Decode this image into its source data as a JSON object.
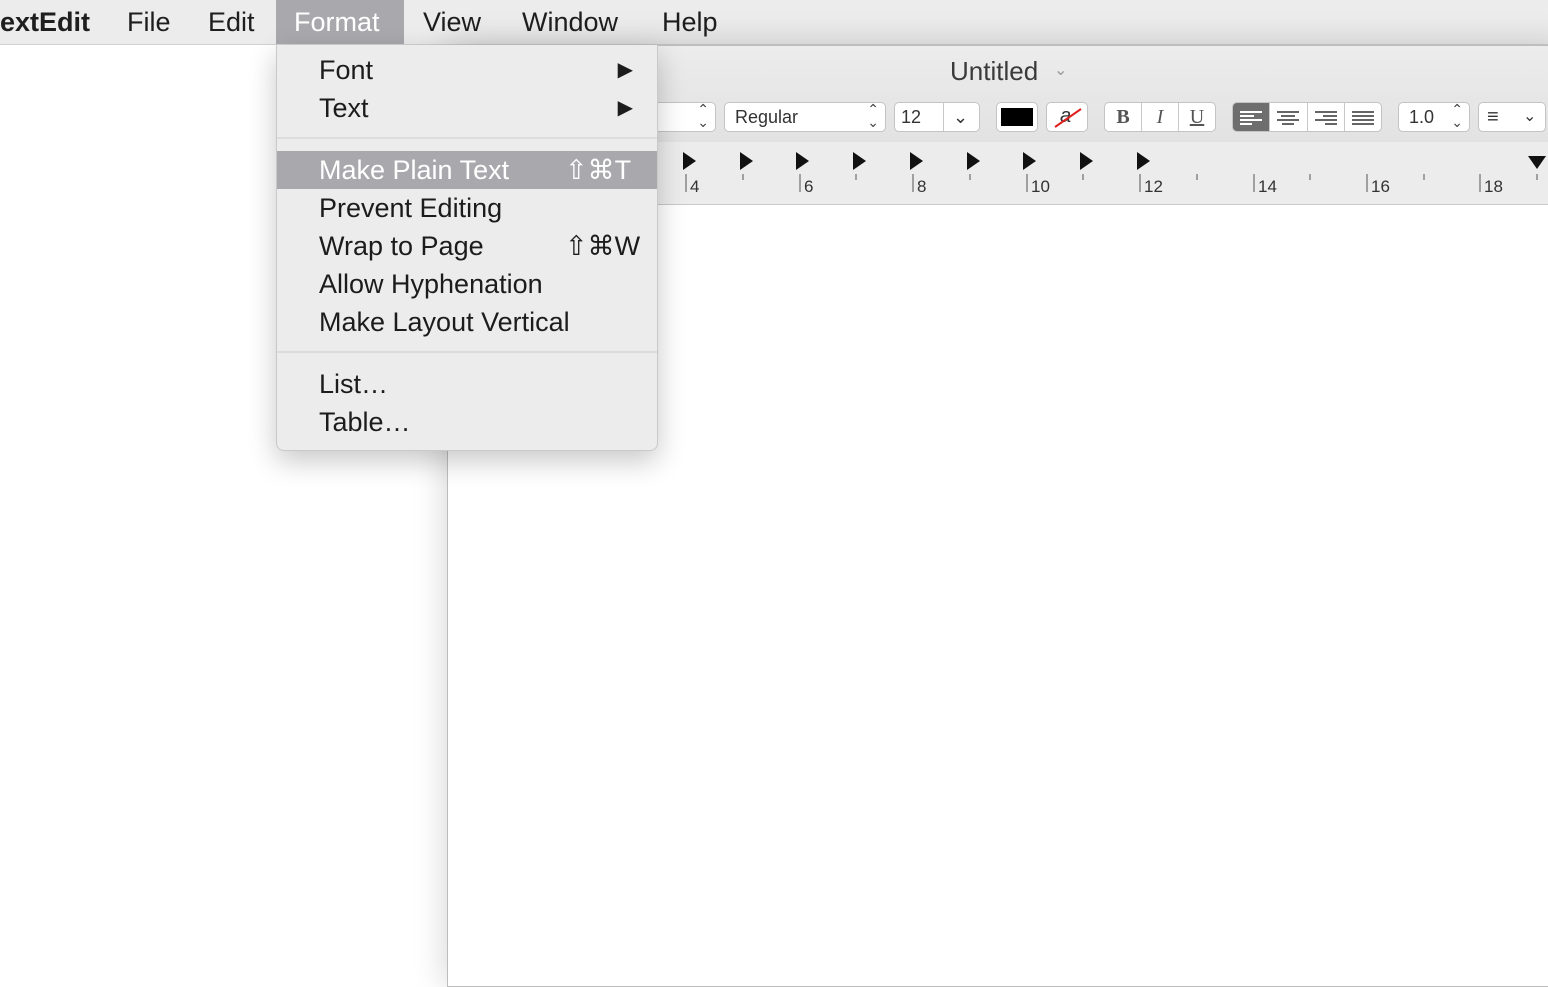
{
  "menubar": {
    "app": "extEdit",
    "items": [
      "File",
      "Edit",
      "Format",
      "View",
      "Window",
      "Help"
    ],
    "active": "Format"
  },
  "window": {
    "title": "Untitled",
    "toolbar": {
      "style": "Regular",
      "size": "12",
      "bold": "B",
      "italic": "I",
      "underline": "U",
      "line_spacing": "1.0",
      "highlight_glyph": "a",
      "text_color": "#000000"
    },
    "ruler_labels": [
      "4",
      "6",
      "8",
      "10",
      "12",
      "14",
      "16",
      "18"
    ]
  },
  "format_menu": {
    "groups": [
      [
        {
          "label": "Font",
          "submenu": true
        },
        {
          "label": "Text",
          "submenu": true
        }
      ],
      [
        {
          "label": "Make Plain Text",
          "shortcut": "⇧⌘T",
          "highlighted": true
        },
        {
          "label": "Prevent Editing"
        },
        {
          "label": "Wrap to Page",
          "shortcut": "⇧⌘W"
        },
        {
          "label": "Allow Hyphenation"
        },
        {
          "label": "Make Layout Vertical"
        }
      ],
      [
        {
          "label": "List…"
        },
        {
          "label": "Table…"
        }
      ]
    ]
  },
  "colors": {
    "highlight": "#a9a9ad",
    "menubar": "#ececec"
  }
}
